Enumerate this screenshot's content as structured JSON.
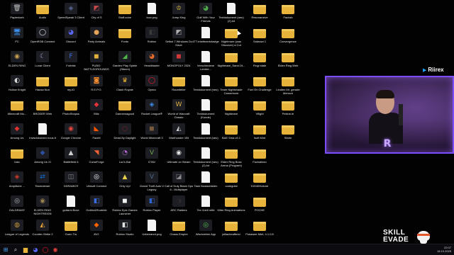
{
  "desktop": {
    "icons": [
      {
        "label": "Papierkorb",
        "icon": "recycle-bin-icon",
        "kind": "app",
        "glyph": "🗑",
        "color": "#c7c7c7"
      },
      {
        "label": "PC",
        "icon": "computer-icon",
        "kind": "app",
        "glyph": "🖥",
        "color": "#3b8ee8"
      },
      {
        "label": "ELDEN RING",
        "icon": "elden-ring-icon",
        "kind": "app",
        "glyph": "◉",
        "color": "#c8a050"
      },
      {
        "label": "Hollow Knight",
        "icon": "hollow-knight-icon",
        "kind": "app",
        "glyph": "◐",
        "color": "#d9d9d9"
      },
      {
        "label": "Minecraft Mo...",
        "icon": "minecraft-icon",
        "kind": "folder",
        "glyph": "",
        "color": ""
      },
      {
        "label": "Among Us",
        "icon": "among-us-icon",
        "kind": "app",
        "glyph": "◆",
        "color": "#e0322f"
      },
      {
        "label": "halo",
        "icon": "folder-icon",
        "kind": "folder",
        "glyph": "",
        "color": ""
      },
      {
        "label": "Amplitube ...",
        "icon": "amplitube-icon",
        "kind": "app",
        "glyph": "◈",
        "color": "#d43d2b"
      },
      {
        "label": "GALDRAMY",
        "icon": "galdramy-icon",
        "kind": "app",
        "glyph": "◎",
        "color": "#b8b8b8"
      },
      {
        "label": "League of Legends",
        "icon": "lol-icon",
        "kind": "app",
        "glyph": "◍",
        "color": "#c89b3c"
      },
      {
        "label": "Audio",
        "icon": "folder-icon",
        "kind": "folder",
        "glyph": "",
        "color": ""
      },
      {
        "label": "OpenRGB Connect",
        "icon": "openrgb-icon",
        "kind": "app",
        "glyph": "◯",
        "color": "#e8e8e8"
      },
      {
        "label": "Lunar Client",
        "icon": "lunar-client-icon",
        "kind": "app",
        "glyph": "☾",
        "color": "#9aa4c8"
      },
      {
        "label": "Hausa Nun",
        "icon": "folder-icon",
        "kind": "folder",
        "glyph": "",
        "color": ""
      },
      {
        "label": "BRODER Web",
        "icon": "folder-icon",
        "kind": "folder",
        "glyph": "",
        "color": ""
      },
      {
        "label": "Invisdokumen nous.lt",
        "icon": "document-icon",
        "kind": "doc",
        "glyph": "",
        "color": ""
      },
      {
        "label": "Among Us XI",
        "icon": "among-us-icon",
        "kind": "app",
        "glyph": "◆",
        "color": "#2d4f9e"
      },
      {
        "label": "Teamviewer",
        "icon": "teamviewer-icon",
        "kind": "app",
        "glyph": "⇄",
        "color": "#0e6ed6"
      },
      {
        "label": "ELDEN RING NIGHTREIGN",
        "icon": "nightreign-icon",
        "kind": "app",
        "glyph": "◉",
        "color": "#9c8452"
      },
      {
        "label": "Counter-Strike 2",
        "icon": "cs2-icon",
        "kind": "app",
        "glyph": "◭",
        "color": "#e8a23a"
      },
      {
        "label": "SpeedSpeak 3 Client",
        "icon": "speedspeak-icon",
        "kind": "app",
        "glyph": "◈",
        "color": "#5a6a9a"
      },
      {
        "label": "Discord",
        "icon": "discord-icon",
        "kind": "app",
        "glyph": "◕",
        "color": "#5865f2"
      },
      {
        "label": "Fortnite",
        "icon": "fortnite-icon",
        "kind": "app",
        "glyph": "F",
        "color": "#3a6de0"
      },
      {
        "label": "my.IO",
        "icon": "myio-icon",
        "kind": "folder",
        "glyph": "",
        "color": ""
      },
      {
        "label": "PhotoShopss",
        "icon": "folder-icon",
        "kind": "folder",
        "glyph": "",
        "color": ""
      },
      {
        "label": "Google Chrome",
        "icon": "chrome-icon",
        "kind": "app",
        "glyph": "◉",
        "color": "#e8453c"
      },
      {
        "label": "Battlefield 6",
        "icon": "battlefield-icon",
        "kind": "app",
        "glyph": "▲",
        "color": "#cfcfcf"
      },
      {
        "label": "DDRAMCR",
        "icon": "ddramcr-icon",
        "kind": "app",
        "glyph": "◫",
        "color": "#8a8a8a"
      },
      {
        "label": "guitar.tr.Bove",
        "icon": "guitar-icon",
        "kind": "doc",
        "glyph": "",
        "color": ""
      },
      {
        "label": "Guen Tru",
        "icon": "folder-icon",
        "kind": "folder",
        "glyph": "",
        "color": ""
      },
      {
        "label": "City of S",
        "icon": "city-icon",
        "kind": "app",
        "glyph": "◩",
        "color": "#c94a4a"
      },
      {
        "label": "Party Animals",
        "icon": "party-animals-icon",
        "kind": "app",
        "glyph": "●",
        "color": "#e6a35a"
      },
      {
        "label": "PUBG: BATTLEGROUNDS",
        "icon": "pubg-icon",
        "kind": "app",
        "glyph": "◼",
        "color": "#e2b03d"
      },
      {
        "label": "R.E.P.O.",
        "icon": "repo-icon",
        "kind": "app",
        "glyph": "◙",
        "color": "#f08c2e"
      },
      {
        "label": "Blitz",
        "icon": "blitz-icon",
        "kind": "app",
        "glyph": "◆",
        "color": "#e3333a"
      },
      {
        "label": "FaceIt",
        "icon": "faceit-icon",
        "kind": "app",
        "glyph": "◣",
        "color": "#ff5500"
      },
      {
        "label": "CurseForge",
        "icon": "curseforge-icon",
        "kind": "app",
        "glyph": "◥",
        "color": "#f16436"
      },
      {
        "label": "Ubisoft Connect",
        "icon": "ubisoft-icon",
        "kind": "app",
        "glyph": "◎",
        "color": "#ffffff"
      },
      {
        "label": "Gothic&Roubble",
        "icon": "roblox-studio-icon",
        "kind": "app",
        "glyph": "◧",
        "color": "#3a6de0"
      },
      {
        "label": "iNG",
        "icon": "ing-icon",
        "kind": "app",
        "glyph": "◆",
        "color": "#ff6200"
      },
      {
        "label": "Stuff.cube",
        "icon": "folder-icon",
        "kind": "folder",
        "glyph": "",
        "color": ""
      },
      {
        "label": "Fonts",
        "icon": "folder-icon",
        "kind": "folder",
        "glyph": "",
        "color": ""
      },
      {
        "label": "Garden Play Spiele (Stimm)",
        "icon": "garden-icon",
        "kind": "app",
        "glyph": "◢",
        "color": "#4fb84a"
      },
      {
        "label": "Clash Royale",
        "icon": "clash-royale-icon",
        "kind": "app",
        "glyph": "♛",
        "color": "#f2b633"
      },
      {
        "label": "Dannemagood",
        "icon": "folder-icon",
        "kind": "folder",
        "glyph": "",
        "color": ""
      },
      {
        "label": "Dead By Daylight",
        "icon": "dbd-icon",
        "kind": "app",
        "glyph": "◌",
        "color": "#b52828"
      },
      {
        "label": "Lux's Bar",
        "icon": "lux-icon",
        "kind": "app",
        "glyph": "◔",
        "color": "#ba6ad8"
      },
      {
        "label": "Only Up!",
        "icon": "only-up-icon",
        "kind": "app",
        "glyph": "▲",
        "color": "#e8d04a"
      },
      {
        "label": "Roblox Epic Games Launcher",
        "icon": "epic-games-icon",
        "kind": "app",
        "glyph": "◼",
        "color": "#f2f2f2"
      },
      {
        "label": "Roblox Studio",
        "icon": "roblox-icon",
        "kind": "app",
        "glyph": "◧",
        "color": "#e2e2e2"
      },
      {
        "label": "icon.png",
        "icon": "image-file-icon",
        "kind": "doc",
        "glyph": "",
        "color": ""
      },
      {
        "label": "Roblox",
        "icon": "roblox-icon",
        "kind": "app",
        "glyph": "◧",
        "color": "#3a3a3a"
      },
      {
        "label": "Headblaster",
        "icon": "headblaster-icon",
        "kind": "app",
        "glyph": "◕",
        "color": "#e26a2a"
      },
      {
        "label": "Opera",
        "icon": "opera-icon",
        "kind": "app",
        "glyph": "◯",
        "color": "#ff1b2d"
      },
      {
        "label": "Rocket League®",
        "icon": "rocket-league-icon",
        "kind": "app",
        "glyph": "◈",
        "color": "#3a8ee8"
      },
      {
        "label": "World Minecraft 3",
        "icon": "minecraft-icon",
        "kind": "app",
        "glyph": "◼",
        "color": "#7a5a3a"
      },
      {
        "label": "GTAV",
        "icon": "gtav-icon",
        "kind": "app",
        "glyph": "V",
        "color": "#6aa84a"
      },
      {
        "label": "Grand Theft Auto V Legacy",
        "icon": "gta-legacy-icon",
        "kind": "app",
        "glyph": "V",
        "color": "#4a6a8a"
      },
      {
        "label": "Roblox Player",
        "icon": "roblox-player-icon",
        "kind": "app",
        "glyph": "◧",
        "color": "#2e64d0"
      },
      {
        "label": "Unbenannt.png",
        "icon": "image-file-icon",
        "kind": "doc",
        "glyph": "",
        "color": ""
      },
      {
        "label": "Jump King",
        "icon": "jump-king-icon",
        "kind": "app",
        "glyph": "♔",
        "color": "#e0c040"
      },
      {
        "label": "Selbst 7 Windows Dc Dave",
        "icon": "app-icon",
        "kind": "app",
        "glyph": "◩",
        "color": "#b0b0b0"
      },
      {
        "label": "MONOPOLY 2024",
        "icon": "monopoly-icon",
        "kind": "app",
        "glyph": "◼",
        "color": "#d23838"
      },
      {
        "label": "Raumteiler",
        "icon": "folder-icon",
        "kind": "folder",
        "glyph": "",
        "color": ""
      },
      {
        "label": "World of Warcraft Classic",
        "icon": "wow-icon",
        "kind": "app",
        "glyph": "W",
        "color": "#e0b040"
      },
      {
        "label": "Warthunder 1Bt",
        "icon": "warthunder-icon",
        "kind": "app",
        "glyph": "◭",
        "color": "#cfcfcf"
      },
      {
        "label": "Ultimate on Steam",
        "icon": "steam-icon",
        "kind": "app",
        "glyph": "◉",
        "color": "#e8e8e8"
      },
      {
        "label": "Call of Duty Black Ops 6 - Multiplayer",
        "icon": "cod-icon",
        "kind": "app",
        "glyph": "◪",
        "color": "#8a8a8a"
      },
      {
        "label": "ARC Raiders",
        "icon": "arc-raiders-icon",
        "kind": "app",
        "glyph": "◑",
        "color": "#2a2a2a"
      },
      {
        "label": "Chaos Empire",
        "icon": "folder-icon",
        "kind": "folder",
        "glyph": "",
        "color": ""
      },
      {
        "label": "Golf With Your Friends",
        "icon": "golf-icon",
        "kind": "app",
        "glyph": "◕",
        "color": "#4fa84a"
      },
      {
        "label": "4TT.rrbeltmertzlastge",
        "icon": "document-icon",
        "kind": "doc",
        "glyph": "",
        "color": ""
      },
      {
        "label": "Verschiedene Lernbe...",
        "icon": "document-icon",
        "kind": "doc",
        "glyph": "",
        "color": ""
      },
      {
        "label": "Textdokument (neu)",
        "icon": "document-icon",
        "kind": "doc",
        "glyph": "",
        "color": ""
      },
      {
        "label": "Textdokument (Kunde)",
        "icon": "document-icon",
        "kind": "doc",
        "glyph": "",
        "color": ""
      },
      {
        "label": "Textdokument (neu)",
        "icon": "document-icon",
        "kind": "doc",
        "glyph": "",
        "color": ""
      },
      {
        "label": "Textdokument (neu) (2).txt",
        "icon": "document-icon",
        "kind": "doc",
        "glyph": "",
        "color": ""
      },
      {
        "label": "Task Nostachtsten",
        "icon": "document-icon",
        "kind": "doc",
        "glyph": "",
        "color": ""
      },
      {
        "label": "Tex Voell nt/bt",
        "icon": "document-icon",
        "kind": "doc",
        "glyph": "",
        "color": ""
      },
      {
        "label": "Wisdomlink App",
        "icon": "wisdomlink-icon",
        "kind": "app",
        "glyph": "◎",
        "color": "#4fc04a"
      },
      {
        "label": "Textdokument (neu) (2).txt",
        "icon": "document-icon",
        "kind": "doc",
        "glyph": "",
        "color": ""
      },
      {
        "label": "Nightmare (was Discover) a Cut",
        "icon": "folder-icon",
        "kind": "folder",
        "glyph": "",
        "color": ""
      },
      {
        "label": "Nightmare_Sand.Ot...",
        "icon": "folder-icon",
        "kind": "folder",
        "glyph": "",
        "color": ""
      },
      {
        "label": "Team Nightshade Camerbook",
        "icon": "folder-icon",
        "kind": "folder",
        "glyph": "",
        "color": ""
      },
      {
        "label": "Nightmare",
        "icon": "folder-icon",
        "kind": "folder",
        "glyph": "",
        "color": ""
      },
      {
        "label": "BAE Sma v5.1",
        "icon": "folder-icon",
        "kind": "folder",
        "glyph": "",
        "color": ""
      },
      {
        "label": "Eldex Ring Boss Arena (Program)",
        "icon": "folder-icon",
        "kind": "folder",
        "glyph": "",
        "color": ""
      },
      {
        "label": "codeguist",
        "icon": "folder-icon",
        "kind": "folder",
        "glyph": "",
        "color": ""
      },
      {
        "label": "Killer Ring Animations",
        "icon": "folder-icon",
        "kind": "folder",
        "glyph": "",
        "color": ""
      },
      {
        "label": "jsiliacheaffend",
        "icon": "folder-icon",
        "kind": "folder",
        "glyph": "",
        "color": ""
      },
      {
        "label": "Resonanzive",
        "icon": "folder-icon",
        "kind": "folder",
        "glyph": "",
        "color": ""
      },
      {
        "label": "Sxilanwi 1",
        "icon": "folder-icon",
        "kind": "folder",
        "glyph": "",
        "color": ""
      },
      {
        "label": "Fingi stale",
        "icon": "folder-icon",
        "kind": "folder",
        "glyph": "",
        "color": ""
      },
      {
        "label": "Fun! En Challenge",
        "icon": "folder-icon",
        "kind": "folder",
        "glyph": "",
        "color": ""
      },
      {
        "label": "Vflight",
        "icon": "folder-icon",
        "kind": "folder",
        "glyph": "",
        "color": ""
      },
      {
        "label": "Isoft Mint",
        "icon": "folder-icon",
        "kind": "folder",
        "glyph": "",
        "color": ""
      },
      {
        "label": "Fachaltezo",
        "icon": "folder-icon",
        "kind": "folder",
        "glyph": "",
        "color": ""
      },
      {
        "label": "DIG40Hotone",
        "icon": "folder-icon",
        "kind": "folder",
        "glyph": "",
        "color": ""
      },
      {
        "label": "POCHE",
        "icon": "folder-icon",
        "kind": "folder",
        "glyph": "",
        "color": ""
      },
      {
        "label": "Pokawee Mint, 4.1.0.5",
        "icon": "folder-icon",
        "kind": "folder",
        "glyph": "",
        "color": ""
      },
      {
        "label": "Fachsb",
        "icon": "folder-icon",
        "kind": "folder",
        "glyph": "",
        "color": ""
      },
      {
        "label": "Convergence",
        "icon": "folder-icon",
        "kind": "folder",
        "glyph": "",
        "color": ""
      },
      {
        "label": "Eldex Ring Web",
        "icon": "folder-icon",
        "kind": "folder",
        "glyph": "",
        "color": ""
      },
      {
        "label": "Lindlen Mt. gerade Mensch",
        "icon": "folder-icon",
        "kind": "folder",
        "glyph": "",
        "color": ""
      },
      {
        "label": "Pelshe.le",
        "icon": "folder-icon",
        "kind": "folder",
        "glyph": "",
        "color": ""
      },
      {
        "label": "Sfahe",
        "icon": "folder-icon",
        "kind": "folder",
        "glyph": "",
        "color": ""
      }
    ]
  },
  "stream": {
    "twitter_handle": "Riirex",
    "cam_logo_letter": "R",
    "brand_word1": "SKILL",
    "brand_word2": "EVADE"
  },
  "taskbar": {
    "items": [
      {
        "icon": "windows-start-icon",
        "glyph": "⊞",
        "color": "#4aa3f0"
      },
      {
        "icon": "search-icon",
        "glyph": "⌕",
        "color": "#dddddd"
      },
      {
        "icon": "file-explorer-icon",
        "glyph": "▆",
        "color": "#e8b33b"
      },
      {
        "icon": "discord-icon",
        "glyph": "◕",
        "color": "#5865f2"
      },
      {
        "icon": "opera-icon",
        "glyph": "◯",
        "color": "#ff1b2d"
      },
      {
        "icon": "chrome-icon",
        "glyph": "◉",
        "color": "#e8453c"
      }
    ],
    "clock_time": "22:07",
    "clock_date": "18.10.2025"
  }
}
